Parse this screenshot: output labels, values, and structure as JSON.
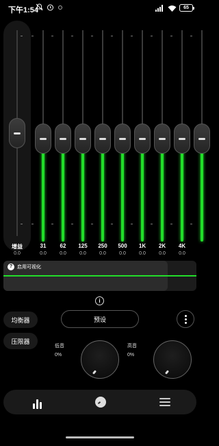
{
  "status_bar": {
    "time": "下午1:54",
    "battery": "65"
  },
  "eq": {
    "gain": {
      "label": "增益",
      "value": "0.0",
      "level": 0.5
    },
    "bands": [
      {
        "freq": "31",
        "value": "0.0",
        "level": 0.5
      },
      {
        "freq": "62",
        "value": "0.0",
        "level": 0.5
      },
      {
        "freq": "125",
        "value": "0.0",
        "level": 0.5
      },
      {
        "freq": "250",
        "value": "0.0",
        "level": 0.5
      },
      {
        "freq": "500",
        "value": "0.0",
        "level": 0.5
      },
      {
        "freq": "1K",
        "value": "0.0",
        "level": 0.5
      },
      {
        "freq": "2K",
        "value": "0.0",
        "level": 0.5
      },
      {
        "freq": "4K",
        "value": "0.0",
        "level": 0.5
      },
      {
        "freq": "",
        "value": "",
        "level": 0.5
      }
    ],
    "accent_color": "#22dd2a"
  },
  "visualizer": {
    "label": "启用可视化"
  },
  "controls": {
    "equalizer_label": "均衡器",
    "limiter_label": "压限器",
    "preset_label": "预设",
    "bass": {
      "label": "低音",
      "value": "0%"
    },
    "treble": {
      "label": "高音",
      "value": "0%"
    }
  },
  "nav": {
    "items": [
      "equalizer-bars-icon",
      "knob-icon",
      "menu-icon"
    ]
  }
}
